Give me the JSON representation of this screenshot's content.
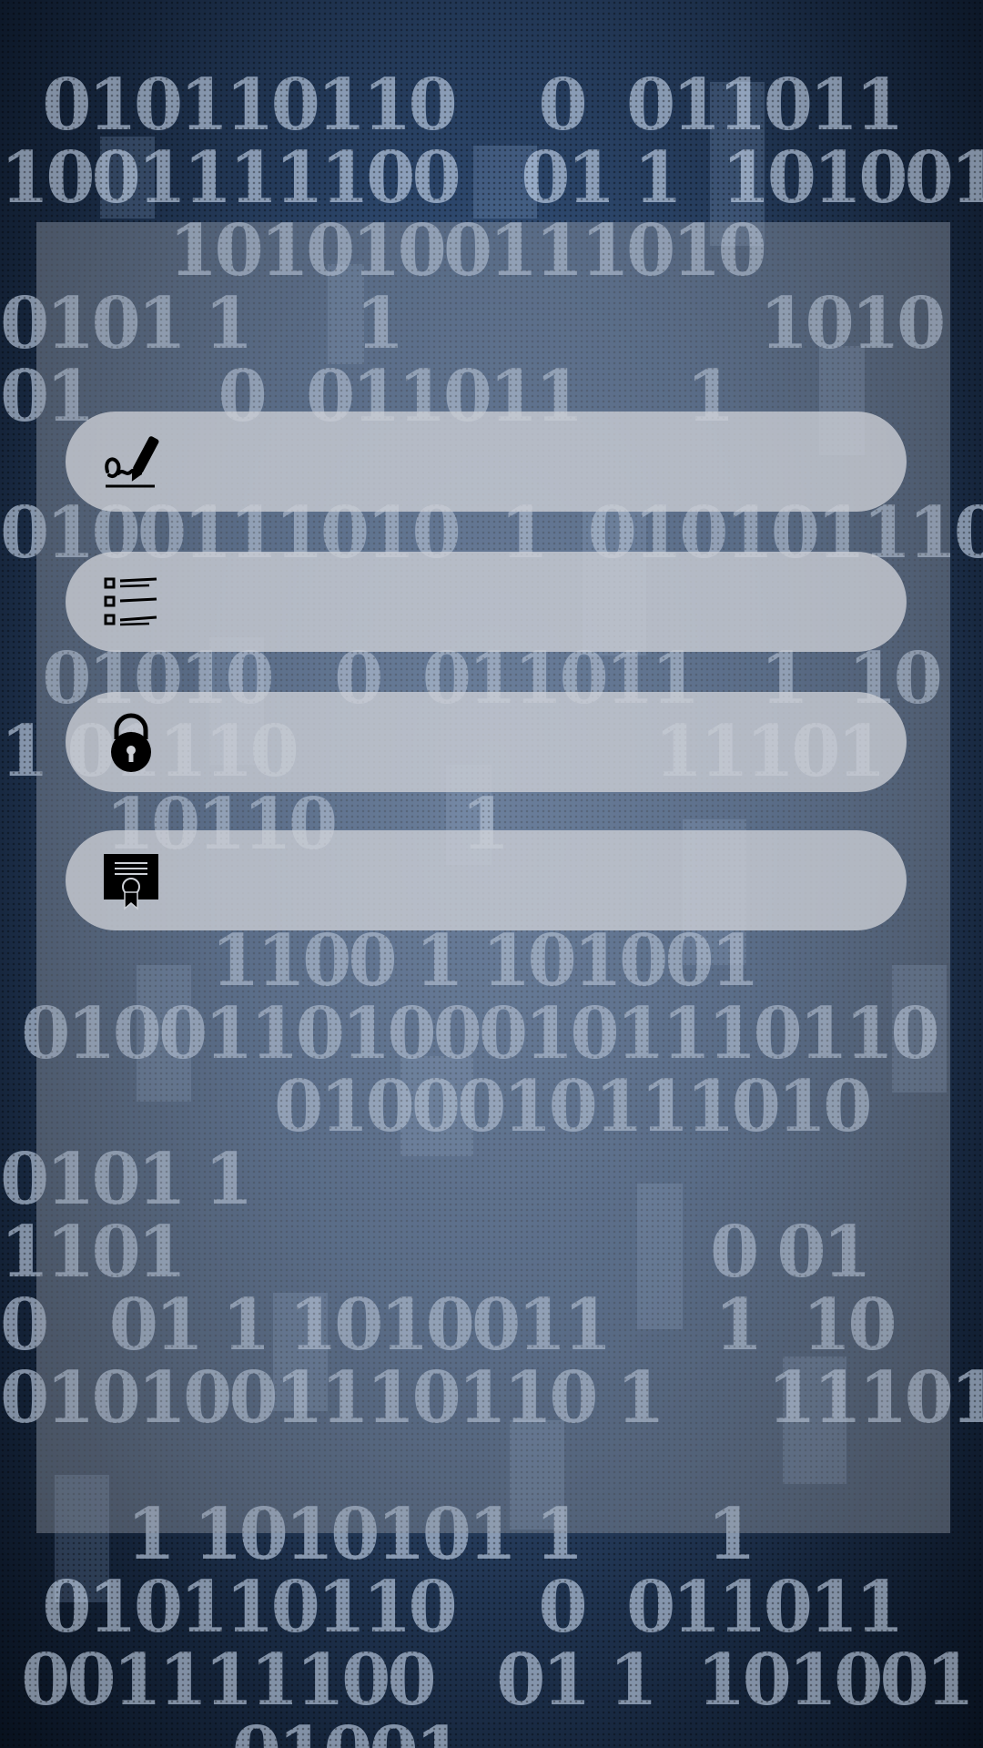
{
  "menu": {
    "items": [
      {
        "id": "signature",
        "icon": "signature-pen-icon",
        "label": ""
      },
      {
        "id": "list",
        "icon": "list-icon",
        "label": ""
      },
      {
        "id": "lock",
        "icon": "padlock-icon",
        "label": ""
      },
      {
        "id": "certificate",
        "icon": "certificate-icon",
        "label": ""
      }
    ]
  },
  "colors": {
    "panel": "#9ea6b2",
    "item": "#cdd0d6",
    "icon": "#000000"
  }
}
